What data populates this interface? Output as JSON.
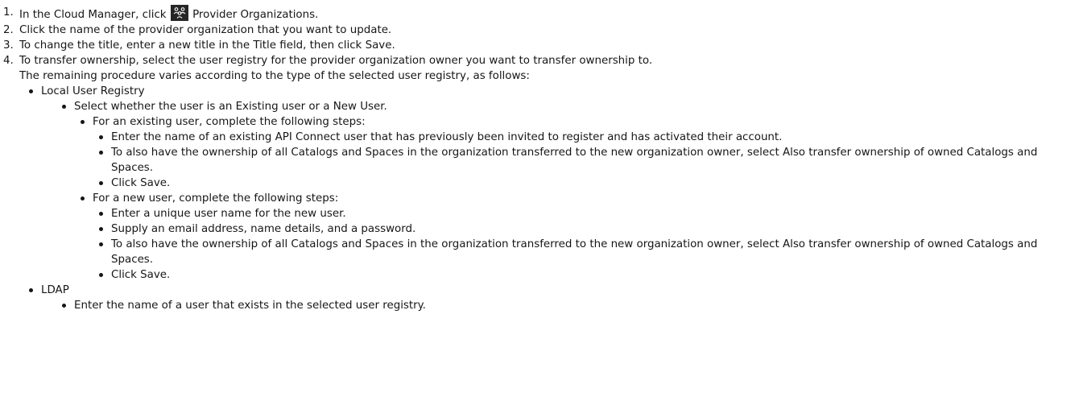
{
  "steps": [
    {
      "num": "1.",
      "before_icon": "In the Cloud Manager, click",
      "icon": "provider-organizations-icon",
      "after_icon": "Provider Organizations."
    },
    {
      "num": "2.",
      "text": "Click the name of the provider organization that you want to update."
    },
    {
      "num": "3.",
      "text": "To change the title, enter a new title in the Title field, then click Save."
    },
    {
      "num": "4.",
      "text": "To transfer ownership, select the user registry for the provider organization owner you want to transfer ownership to.",
      "continuation": "The remaining procedure varies according to the type of the selected user registry, as follows:"
    }
  ],
  "registries": {
    "local": {
      "label": "Local User Registry",
      "select": "Select whether the user is an Existing user or a New User.",
      "existing": {
        "intro": "For an existing user, complete the following steps:",
        "items": [
          "Enter the name of an existing API Connect user that has previously been invited to register and has activated their account.",
          "To also have the ownership of all Catalogs and Spaces in the organization transferred to the new organization owner, select Also transfer ownership of owned Catalogs and Spaces.",
          "Click Save."
        ]
      },
      "new": {
        "intro": "For a new user, complete the following steps:",
        "items": [
          "Enter a unique user name for the new user.",
          "Supply an email address, name details, and a password.",
          "To also have the ownership of all Catalogs and Spaces in the organization transferred to the new organization owner, select Also transfer ownership of owned Catalogs and Spaces.",
          "Click Save."
        ]
      }
    },
    "ldap": {
      "label": "LDAP",
      "items": [
        "Enter the name of a user that exists in the selected user registry."
      ]
    }
  }
}
